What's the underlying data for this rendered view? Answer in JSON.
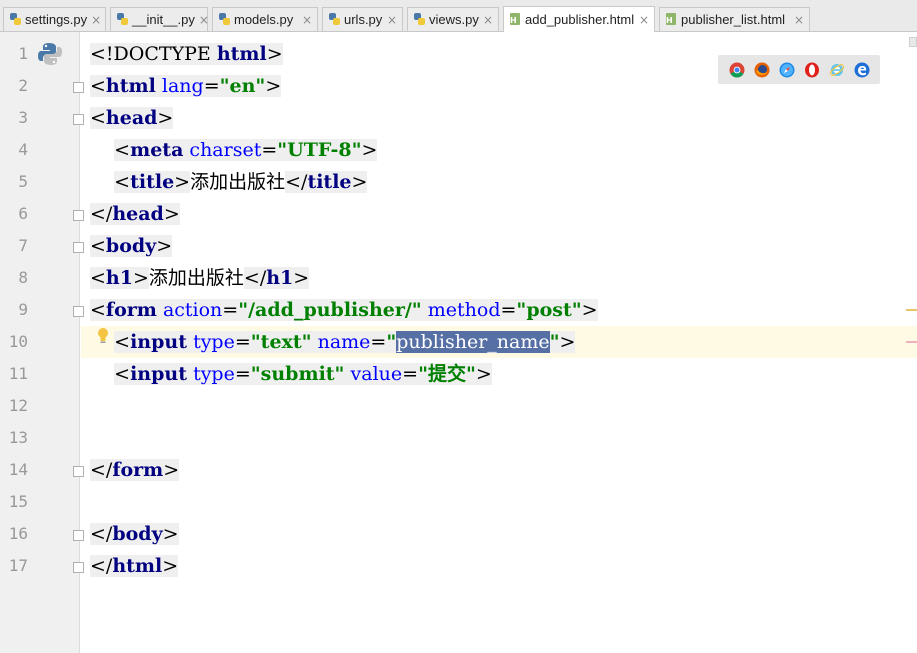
{
  "tabs": [
    {
      "label": "settings.py",
      "type": "py",
      "active": false
    },
    {
      "label": "__init__.py",
      "type": "py",
      "active": false
    },
    {
      "label": "models.py",
      "type": "py",
      "active": false
    },
    {
      "label": "urls.py",
      "type": "py",
      "active": false
    },
    {
      "label": "views.py",
      "type": "py",
      "active": false
    },
    {
      "label": "add_publisher.html",
      "type": "html",
      "active": true
    },
    {
      "label": "publisher_list.html",
      "type": "html",
      "active": false
    }
  ],
  "close_glyph": "×",
  "line_numbers": [
    "1",
    "2",
    "3",
    "4",
    "5",
    "6",
    "7",
    "8",
    "9",
    "10",
    "11",
    "12",
    "13",
    "14",
    "15",
    "16",
    "17"
  ],
  "code": {
    "l1": {
      "lt": "<",
      "doctype": "!DOCTYPE ",
      "html": "html",
      "gt": ">"
    },
    "l2": {
      "lt": "<",
      "tag": "html",
      "sp": " ",
      "attr": "lang",
      "eq": "=",
      "val": "\"en\"",
      "gt": ">"
    },
    "l3": {
      "lt": "<",
      "tag": "head",
      "gt": ">"
    },
    "l4": {
      "indent": "    ",
      "lt": "<",
      "tag": "meta",
      "sp": " ",
      "attr": "charset",
      "eq": "=",
      "val": "\"UTF-8\"",
      "gt": ">"
    },
    "l5": {
      "indent": "    ",
      "lt": "<",
      "tag": "title",
      "gt": ">",
      "text": "添加出版社",
      "lt2": "</",
      "tag2": "title",
      "gt2": ">"
    },
    "l6": {
      "lt": "</",
      "tag": "head",
      "gt": ">"
    },
    "l7": {
      "lt": "<",
      "tag": "body",
      "gt": ">"
    },
    "l8": {
      "lt": "<",
      "tag": "h1",
      "gt": ">",
      "text": "添加出版社",
      "lt2": "</",
      "tag2": "h1",
      "gt2": ">"
    },
    "l9": {
      "lt": "<",
      "tag": "form",
      "sp": " ",
      "attr1": "action",
      "eq1": "=",
      "val1": "\"/add_publisher/\"",
      "sp2": " ",
      "attr2": "method",
      "eq2": "=",
      "val2": "\"post\"",
      "gt": ">"
    },
    "l10": {
      "indent": "    ",
      "lt": "<",
      "tag": "input",
      "sp": " ",
      "attr1": "type",
      "eq1": "=",
      "val1": "\"text\"",
      "sp2": " ",
      "attr2": "name",
      "eq2": "=",
      "q1": "\"",
      "sel": "publisher_name",
      "q2": "\"",
      "gt": ">"
    },
    "l11": {
      "indent": "    ",
      "lt": "<",
      "tag": "input",
      "sp": " ",
      "attr1": "type",
      "eq1": "=",
      "val1": "\"submit\"",
      "sp2": " ",
      "attr2": "value",
      "eq2": "=",
      "val2": "\"提交\"",
      "gt": ">"
    },
    "l14": {
      "lt": "</",
      "tag": "form",
      "gt": ">"
    },
    "l16": {
      "lt": "</",
      "tag": "body",
      "gt": ">"
    },
    "l17": {
      "lt": "</",
      "tag": "html",
      "gt": ">"
    }
  },
  "browser_icons": [
    "chrome-icon",
    "firefox-icon",
    "safari-icon",
    "opera-icon",
    "ie-icon",
    "edge-icon"
  ],
  "colors": {
    "tag": "#000080",
    "attr": "#0000ff",
    "string": "#008000",
    "selection": "#5670a5",
    "current_line": "#fffae3"
  }
}
